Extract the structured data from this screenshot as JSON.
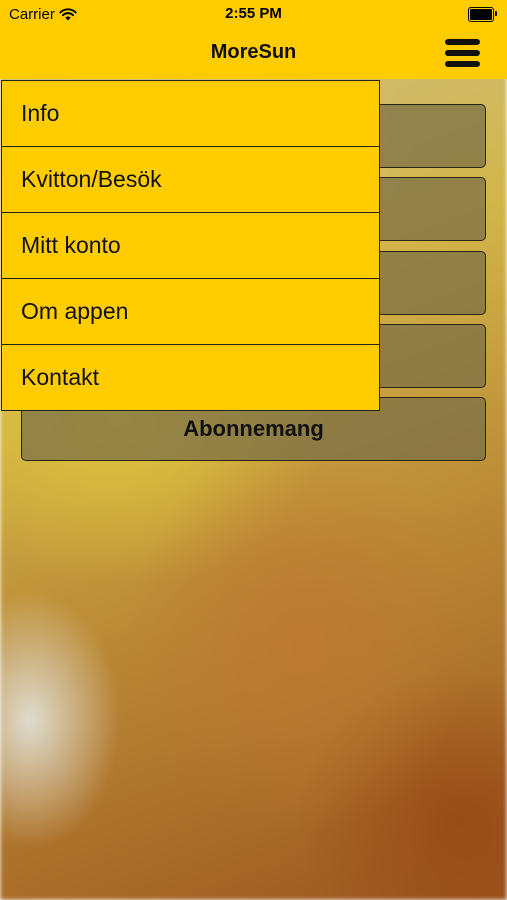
{
  "status_bar": {
    "carrier": "Carrier",
    "time": "2:55 PM",
    "wifi_icon": "wifi-icon",
    "battery_icon": "battery-icon"
  },
  "nav": {
    "title": "MoreSun",
    "menu_icon": "hamburger-menu-icon"
  },
  "background_buttons": [
    {
      "label": ""
    },
    {
      "label": ""
    },
    {
      "label": ""
    },
    {
      "label": ""
    },
    {
      "label": "Abonnemang"
    }
  ],
  "menu": {
    "items": [
      {
        "label": "Info"
      },
      {
        "label": "Kvitton/Besök"
      },
      {
        "label": "Mitt konto"
      },
      {
        "label": "Om appen"
      },
      {
        "label": "Kontakt"
      }
    ]
  },
  "colors": {
    "accent": "#ffcc00"
  }
}
